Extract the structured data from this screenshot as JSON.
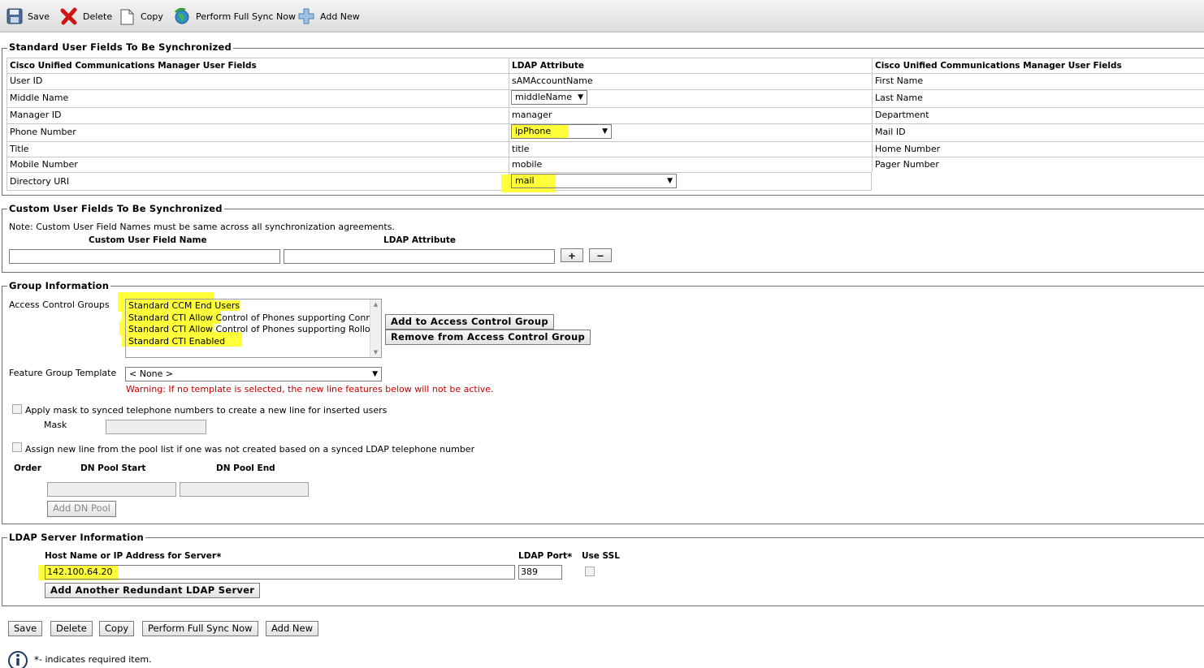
{
  "toolbar": {
    "save": "Save",
    "delete": "Delete",
    "copy": "Copy",
    "sync": "Perform Full Sync Now",
    "add_new": "Add New"
  },
  "standard_fields": {
    "legend": "Standard User Fields To Be Synchronized",
    "headers": [
      "Cisco Unified Communications Manager User Fields",
      "LDAP Attribute",
      "Cisco Unified Communications Manager User Fields"
    ],
    "rows": [
      {
        "field": "User ID",
        "ldap": "sAMAccountName",
        "field2": "First Name"
      },
      {
        "field": "Middle Name",
        "ldap": "middleName",
        "field2": "Last Name"
      },
      {
        "field": "Manager ID",
        "ldap": "manager",
        "field2": "Department"
      },
      {
        "field": "Phone Number",
        "ldap": "ipPhone",
        "field2": "Mail ID"
      },
      {
        "field": "Title",
        "ldap": "title",
        "field2": "Home Number"
      },
      {
        "field": "Mobile Number",
        "ldap": "mobile",
        "field2": "Pager Number"
      },
      {
        "field": "Directory URI",
        "ldap": "mail",
        "field2": ""
      }
    ]
  },
  "custom_fields": {
    "legend": "Custom User Fields To Be Synchronized",
    "note": "Note: Custom User Field Names must be same across all synchronization agreements.",
    "col_name": "Custom User Field Name",
    "col_ldap": "LDAP Attribute",
    "name_value": "",
    "ldap_value": "",
    "add_icon": "+",
    "remove_icon": "−"
  },
  "group_info": {
    "legend": "Group Information",
    "acg_label": "Access Control Groups",
    "acg_items": [
      "Standard CCM End Users",
      "Standard CTI Allow Control of Phones supporting Connected Xfer and conf",
      "Standard CTI Allow Control of Phones supporting Rollover Mode",
      "Standard CTI Enabled"
    ],
    "add_btn": "Add to Access Control Group",
    "remove_btn": "Remove from Access Control Group",
    "fgt_label": "Feature Group Template",
    "fgt_value": "< None >",
    "warning": "Warning: If no template is selected, the new line features below will not be active.",
    "mask_chk_label": "Apply mask to synced telephone numbers to create a new line for inserted users",
    "mask_label": "Mask",
    "pool_chk_label": "Assign new line from the pool list if one was not created based on a synced LDAP telephone number",
    "order_hdr": "Order",
    "pool_start_hdr": "DN Pool Start",
    "pool_end_hdr": "DN Pool End",
    "add_pool_btn": "Add DN Pool"
  },
  "ldap_server": {
    "legend": "LDAP Server Information",
    "host_label": "Host Name or IP Address for Server",
    "port_label": "LDAP Port",
    "ssl_label": "Use SSL",
    "required_mark": "*",
    "host_value": "142.100.64.20",
    "port_value": "389",
    "add_redundant_btn": "Add Another Redundant LDAP Server"
  },
  "bottom_buttons": {
    "save": "Save",
    "delete": "Delete",
    "copy": "Copy",
    "sync": "Perform Full Sync Now",
    "add_new": "Add New"
  },
  "footer": {
    "required_mark": "*",
    "required_note": "- indicates required item."
  },
  "colors": {
    "highlight": "#ffff3a",
    "warning": "#cc0000"
  }
}
